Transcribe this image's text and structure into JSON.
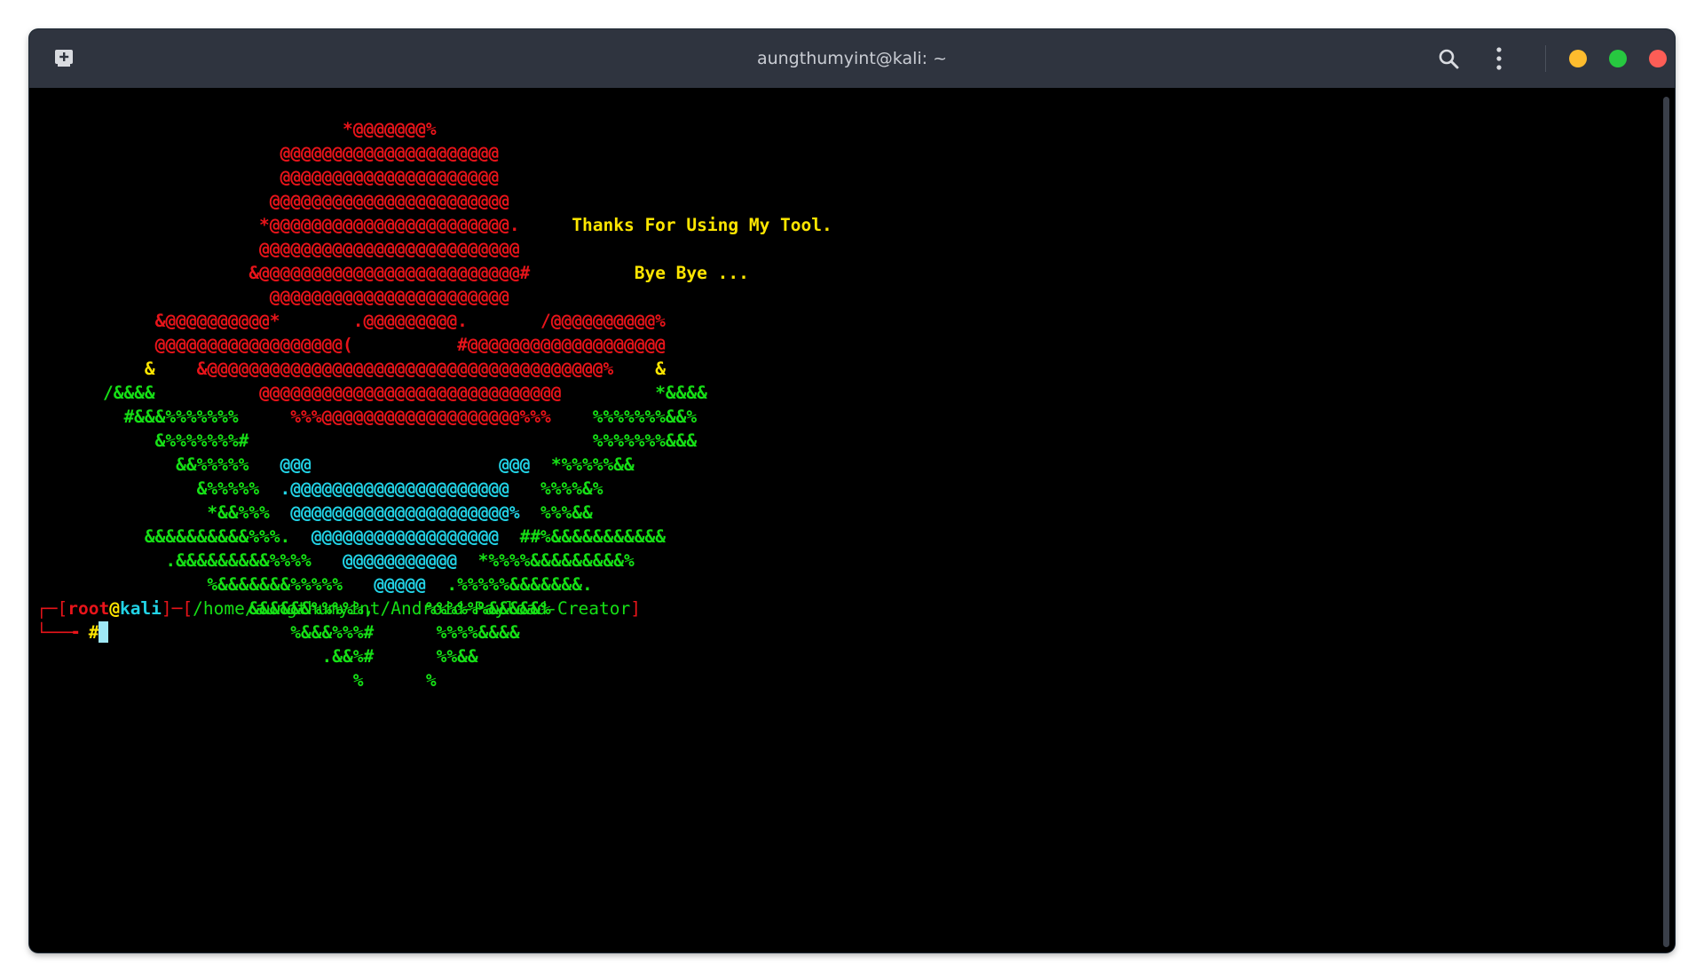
{
  "window": {
    "title": "aungthumyint@kali: ~",
    "icons": {
      "new_tab": "new-tab-icon",
      "search": "search-icon",
      "menu": "kebab-menu-icon"
    },
    "controls_colors": {
      "minimize": "#fdbc2e",
      "maximize": "#27c840",
      "close": "#fd5d56"
    }
  },
  "terminal": {
    "banner_lines": [
      {
        "color": "red",
        "text": "                           *@@@@@@@%"
      },
      {
        "color": "red",
        "text": "                     @@@@@@@@@@@@@@@@@@@@@"
      },
      {
        "color": "red",
        "text": "                     @@@@@@@@@@@@@@@@@@@@@"
      },
      {
        "color": "red",
        "text": "                    @@@@@@@@@@@@@@@@@@@@@@@"
      },
      {
        "color": "red",
        "text": "                   *@@@@@@@@@@@@@@@@@@@@@@@.",
        "message": "     Thanks For Using My Tool."
      },
      {
        "color": "red",
        "text": "                   @@@@@@@@@@@@@@@@@@@@@@@@@"
      },
      {
        "color": "red",
        "text": "                  &@@@@@@@@@@@@@@@@@@@@@@@@@#",
        "message": "          Bye Bye ..."
      },
      {
        "color": "red",
        "text": "                    @@@@@@@@@@@@@@@@@@@@@@@"
      },
      {
        "color": "red",
        "text": "         &@@@@@@@@@@*       .@@@@@@@@@.       /@@@@@@@@@@%"
      },
      {
        "color": "red",
        "text": "         @@@@@@@@@@@@@@@@@@(          #@@@@@@@@@@@@@@@@@@@"
      },
      {
        "color": "mixed1",
        "segments": [
          [
            "yellow",
            "        &    "
          ],
          [
            "red",
            "&@@@@@@@@@@@@@@@@@@@@@@@@@@@@@@@@@@@@@@%"
          ],
          [
            "yellow",
            "    &"
          ]
        ]
      },
      {
        "color": "mixed2",
        "segments": [
          [
            "green",
            "    /&&&&          "
          ],
          [
            "red",
            "@@@@@@@@@@@@@@@@@@@@@@@@@@@@@"
          ],
          [
            "green",
            "         *&&&&"
          ]
        ]
      },
      {
        "color": "mixed3",
        "segments": [
          [
            "green",
            "      #&&&%%%%%%%     "
          ],
          [
            "red",
            "%%%@@@@@@@@@@@@@@@@@@@%%%"
          ],
          [
            "green",
            "    %%%%%%%&&%"
          ]
        ]
      },
      {
        "color": "green",
        "text": "         &%%%%%%%#                                 %%%%%%%&&&"
      },
      {
        "color": "mixed4",
        "segments": [
          [
            "green",
            "           &&%%%%%   "
          ],
          [
            "cyan",
            "@@@"
          ],
          [
            "green",
            "                  "
          ],
          [
            "cyan",
            "@@@"
          ],
          [
            "green",
            "  *%%%%%&&"
          ]
        ]
      },
      {
        "color": "mixed5",
        "segments": [
          [
            "green",
            "             &%%%%%  "
          ],
          [
            "cyan",
            ".@@@@@@@@@@@@@@@@@@@@@"
          ],
          [
            "green",
            "   %%%%&%"
          ]
        ]
      },
      {
        "color": "mixed6",
        "segments": [
          [
            "green",
            "              *&&%%%  "
          ],
          [
            "cyan",
            "@@@@@@@@@@@@@@@@@@@@@%"
          ],
          [
            "green",
            "  %%%&&"
          ]
        ]
      },
      {
        "color": "mixed7",
        "segments": [
          [
            "green",
            "        &&&&&&&&&&%%%.  "
          ],
          [
            "cyan",
            "@@@@@@@@@@@@@@@@@@"
          ],
          [
            "green",
            "  ##%&&&&&&&&&&&"
          ]
        ]
      },
      {
        "color": "mixed8",
        "segments": [
          [
            "green",
            "          .&&&&&&&&&%%%%   "
          ],
          [
            "cyan",
            "@@@@@@@@@@@"
          ],
          [
            "green",
            "  *%%%%&&&&&&&&&%"
          ]
        ]
      },
      {
        "color": "mixed9",
        "segments": [
          [
            "green",
            "              %&&&&&&&%%%%%   "
          ],
          [
            "cyan",
            "@@@@@"
          ],
          [
            "green",
            "  .%%%%%&&&&&&&."
          ]
        ]
      },
      {
        "color": "green",
        "text": "                  &&&&&&%%%%%,     %%%%%%&&&&&%"
      },
      {
        "color": "green",
        "text": "                      %&&&%%%#      %%%%&&&&"
      },
      {
        "color": "green",
        "text": "                         .&&%#      %%&&"
      },
      {
        "color": "green",
        "text": "                            %      %"
      }
    ],
    "prompt": {
      "user": "root",
      "at": "@",
      "host": "kali",
      "path": "/home/aungthumyint/Android-Payload-Creator",
      "symbol": "#"
    }
  }
}
